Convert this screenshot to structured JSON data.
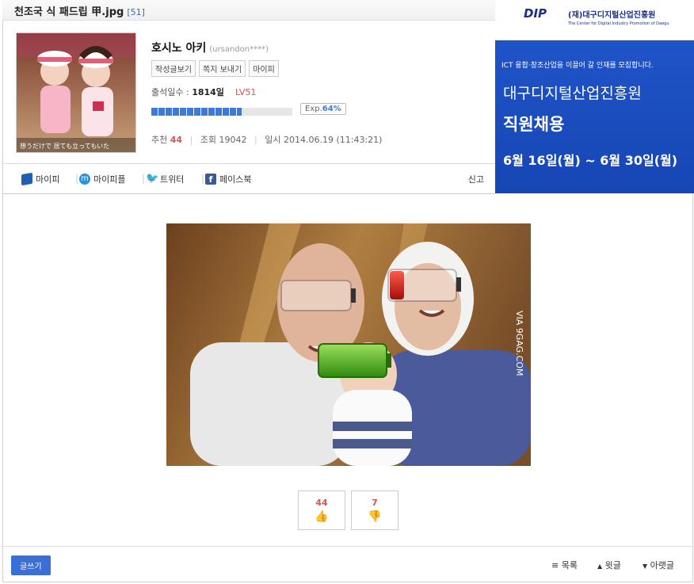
{
  "post": {
    "title": "천조국 식 패드립 甲.jpg",
    "comment_count": "[51]"
  },
  "user": {
    "name": "호시노 아키",
    "id": "(ursandon****)",
    "buttons": [
      "작성글보기",
      "쪽지 보내기",
      "마이피"
    ],
    "attendance_label": "출석일수 : ",
    "attendance_value": "1814일",
    "level": "LV51",
    "exp_label": "Exp.",
    "exp_value": "64%",
    "exp_progress": 0.64,
    "avatar_caption": "想うだけで 居ても立ってもいた"
  },
  "stats": {
    "recommend_label": "추천",
    "recommend_value": "44",
    "views_label": "조회",
    "views_value": "19042",
    "date_label": "일시",
    "date_value": "2014.06.19 (11:43:21)"
  },
  "share": {
    "items": [
      "마이피",
      "마이피플",
      "트위터",
      "페이스북"
    ],
    "report": "신고"
  },
  "ad": {
    "logo": "DIP",
    "org": "(재)대구디지털산업진흥원",
    "org_en": "The Center for Digital Industry Promotion of Daegu",
    "line1": "ICT 융합·창조산업을 이끌어 갈 인재를 모집합니다.",
    "line2": "대구디지털산업진흥원",
    "line3": "직원채용",
    "line4": "6월 16일(월) ~ 6월 30일(월)"
  },
  "image": {
    "watermark": "VIA 9GAG.COM"
  },
  "votes": {
    "up": "44",
    "down": "7"
  },
  "footer": {
    "write": "글쓰기",
    "list": "목록",
    "prev": "윗글",
    "next": "아랫글"
  },
  "colors": {
    "accent": "#3a6fd8",
    "red": "#d9534f",
    "ad_blue": "#1f54c8"
  }
}
